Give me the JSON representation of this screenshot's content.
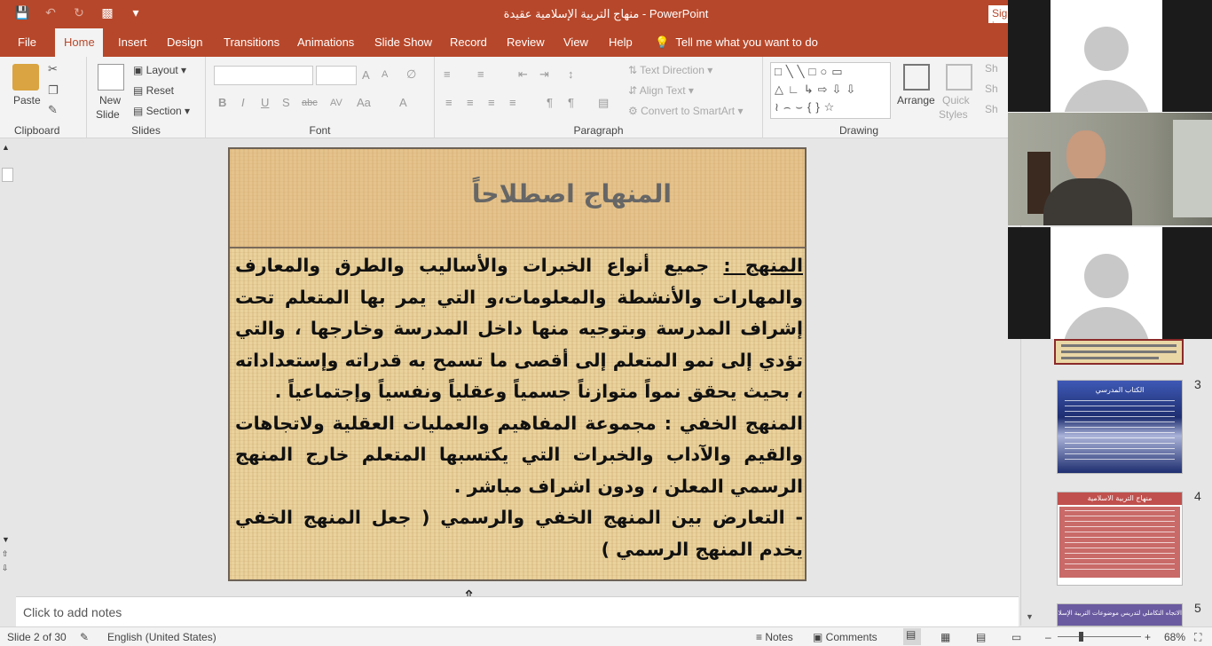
{
  "titlebar": {
    "title": "منهاج التربية الإسلامية عقيدة  -  PowerPoint",
    "signin": "Sign in"
  },
  "tabs": [
    "File",
    "Home",
    "Insert",
    "Design",
    "Transitions",
    "Animations",
    "Slide Show",
    "Record",
    "Review",
    "View",
    "Help"
  ],
  "tellme": "Tell me what you want to do",
  "ribbon": {
    "clipboard": {
      "label": "Clipboard",
      "paste": "Paste"
    },
    "slides": {
      "label": "Slides",
      "new_slide": "New",
      "new_slide2": "Slide",
      "layout": "Layout",
      "reset": "Reset",
      "section": "Section"
    },
    "font": {
      "label": "Font",
      "bold": "B",
      "italic": "I",
      "underline": "U",
      "shadow": "S",
      "strike": "abc",
      "spacing": "AV",
      "case": "Aa",
      "color": "A",
      "grow": "A",
      "shrink": "A"
    },
    "paragraph": {
      "label": "Paragraph",
      "text_direction": "Text Direction",
      "align_text": "Align Text",
      "smartart": "Convert to SmartArt"
    },
    "drawing": {
      "label": "Drawing",
      "arrange": "Arrange",
      "quick_styles": "Quick",
      "quick_styles2": "Styles",
      "shape_fill": "Sh",
      "shape_outline": "Sh",
      "shape_effects": "Sh"
    }
  },
  "slide": {
    "title": "المنهاج اصطلاحاً",
    "para1_term": "المنهج :",
    "para1": " جميع أنواع الخبرات والأساليب والطرق والمعارف والمهارات والأنشطة والمعلومات،و التي يمر بها المتعلم تحت إشراف المدرسة وبتوجيه منها داخل المدرسة وخارجها ، والتي تؤدي إلى نمو المتعلم إلى أقصى ما تسمح به قدراته وإستعداداته ، بحيث يحقق نمواً متوازناً جسمياً وعقلياً ونفسياً وإجتماعياً .",
    "para2": "المنهج الخفي : مجموعة المفاهيم والعمليات العقلية ولاتجاهات والقيم والآداب والخبرات التي يكتسبها المتعلم خارج المنهج الرسمي المعلن ، ودون اشراف مباشر .",
    "para3": "- التعارض بين المنهج الخفي والرسمي ( جعل المنهج الخفي يخدم المنهج الرسمي )"
  },
  "notes": {
    "placeholder": "Click to add notes"
  },
  "thumbnails": [
    {
      "num": "3",
      "title": "الكتاب المدرسي",
      "bg": "#2a3f8f"
    },
    {
      "num": "4",
      "title": "منهاج التربية الاسلامية",
      "bg": "#c0504d"
    },
    {
      "num": "5",
      "title": "الاتجاه التكاملي لتدريس موضوعات التربية الإسلامية",
      "bg": "#6a5aa0"
    }
  ],
  "status": {
    "slide": "Slide 2 of 30",
    "language": "English (United States)",
    "notes": "Notes",
    "comments": "Comments",
    "zoom": "68%"
  },
  "colors": {
    "accent": "#b7472a",
    "slide_bg": "#e8cf99"
  }
}
